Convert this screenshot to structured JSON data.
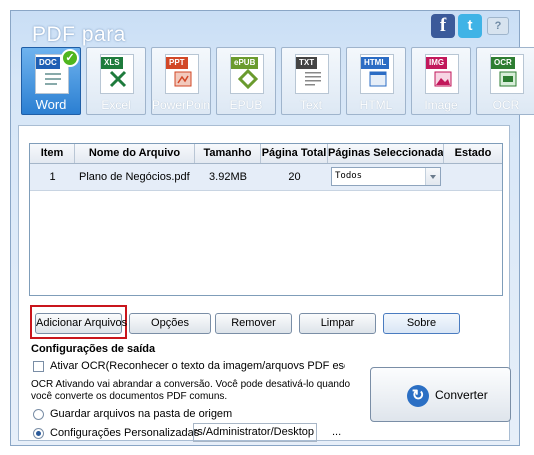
{
  "app": {
    "title": "PDF para"
  },
  "social": {
    "facebook": "f",
    "twitter": "t",
    "help": "?"
  },
  "tabs": [
    {
      "label": "Word",
      "filetype": "DOC",
      "color": "#1f5fb4",
      "active": true
    },
    {
      "label": "Excel",
      "filetype": "XLS",
      "color": "#1e7b3c",
      "active": false
    },
    {
      "label": "PowerPoint",
      "filetype": "PPT",
      "color": "#d24726",
      "active": false
    },
    {
      "label": "EPUB",
      "filetype": "ePUB",
      "color": "#6a9b2e",
      "active": false
    },
    {
      "label": "Text",
      "filetype": "TXT",
      "color": "#444444",
      "active": false
    },
    {
      "label": "HTML",
      "filetype": "HTML",
      "color": "#2b6cc4",
      "active": false
    },
    {
      "label": "Image",
      "filetype": "IMG",
      "color": "#c2185b",
      "active": false
    },
    {
      "label": "OCR",
      "filetype": "OCR",
      "color": "#2e7d32",
      "active": false
    }
  ],
  "table": {
    "headers": [
      "Item",
      "Nome do Arquivo",
      "Tamanho",
      "Página Total",
      "Páginas Seleccionadas",
      "Estado"
    ],
    "rows": [
      {
        "item": "1",
        "name": "Plano de Negócios.pdf",
        "size": "3.92MB",
        "pages": "20",
        "selected": "Todos",
        "state": ""
      }
    ]
  },
  "buttons": {
    "add": "Adicionar Arquivos",
    "options": "Opções",
    "remove": "Remover",
    "clear": "Limpar",
    "about": "Sobre"
  },
  "output": {
    "section_title": "Configurações de saída",
    "ocr_label": "Ativar OCR(Reconhecer o texto da imagem/arquovs PDF escaneado",
    "ocr_info": "OCR Ativando vai abrandar a conversão. Você pode desativá-lo quando você converte os documentos PDF comuns.",
    "radio_source": "Guardar arquivos na pasta de origem",
    "radio_custom": "Configurações Personalizadas",
    "path": "C:/Users/Administrator/Desktop",
    "browse": "..."
  },
  "convert": {
    "label": "Converter"
  }
}
